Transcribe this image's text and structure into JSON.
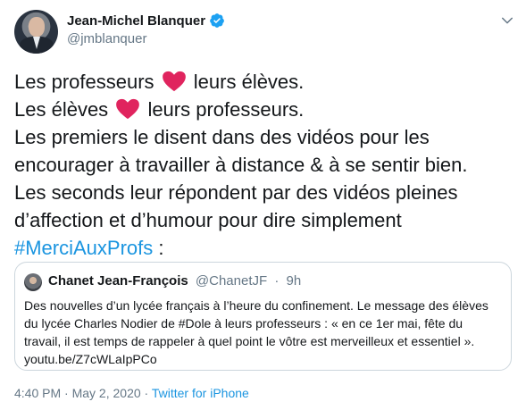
{
  "author": {
    "name": "Jean-Michel Blanquer",
    "handle": "@jmblanquer",
    "verified": true
  },
  "tweet": {
    "lines": [
      {
        "before": "Les professeurs",
        "after": "leurs élèves."
      },
      {
        "before": "Les élèves",
        "after": "leurs professeurs."
      },
      {
        "text": "Les premiers le disent dans des vidéos pour les"
      },
      {
        "text": "encourager à travailler à distance & à se sentir bien."
      },
      {
        "text": "Les seconds leur répondent par des vidéos pleines"
      },
      {
        "text": "d’affection et d’humour pour dire simplement"
      }
    ],
    "hashtag": "#MerciAuxProfs",
    "hashtag_suffix": " :"
  },
  "quoted_tweet": {
    "name": "Chanet Jean-François",
    "handle": "@ChanetJF",
    "separator": "·",
    "age": "9h",
    "body_lines": [
      "Des nouvelles d’un lycée français à l’heure du confinement. Le message des élèves",
      "du lycée Charles Nodier de #Dole à leurs professeurs : « en ce 1er mai, fête du",
      "travail, il est temps de rappeler à quel point le vôtre est merveilleux et essentiel ».",
      "youtu.be/Z7cWLaIpPCo"
    ]
  },
  "footer": {
    "time": "4:40 PM",
    "separator1": "·",
    "date": "May 2, 2020",
    "separator2": "·",
    "source": "Twitter for iPhone"
  },
  "colors": {
    "link": "#1b95e0",
    "heart": "#e0245e",
    "verified": "#1da1f2",
    "secondary_text": "#657786"
  },
  "icons": [
    "verified-badge-icon",
    "chevron-down-icon",
    "red-heart-icon"
  ]
}
